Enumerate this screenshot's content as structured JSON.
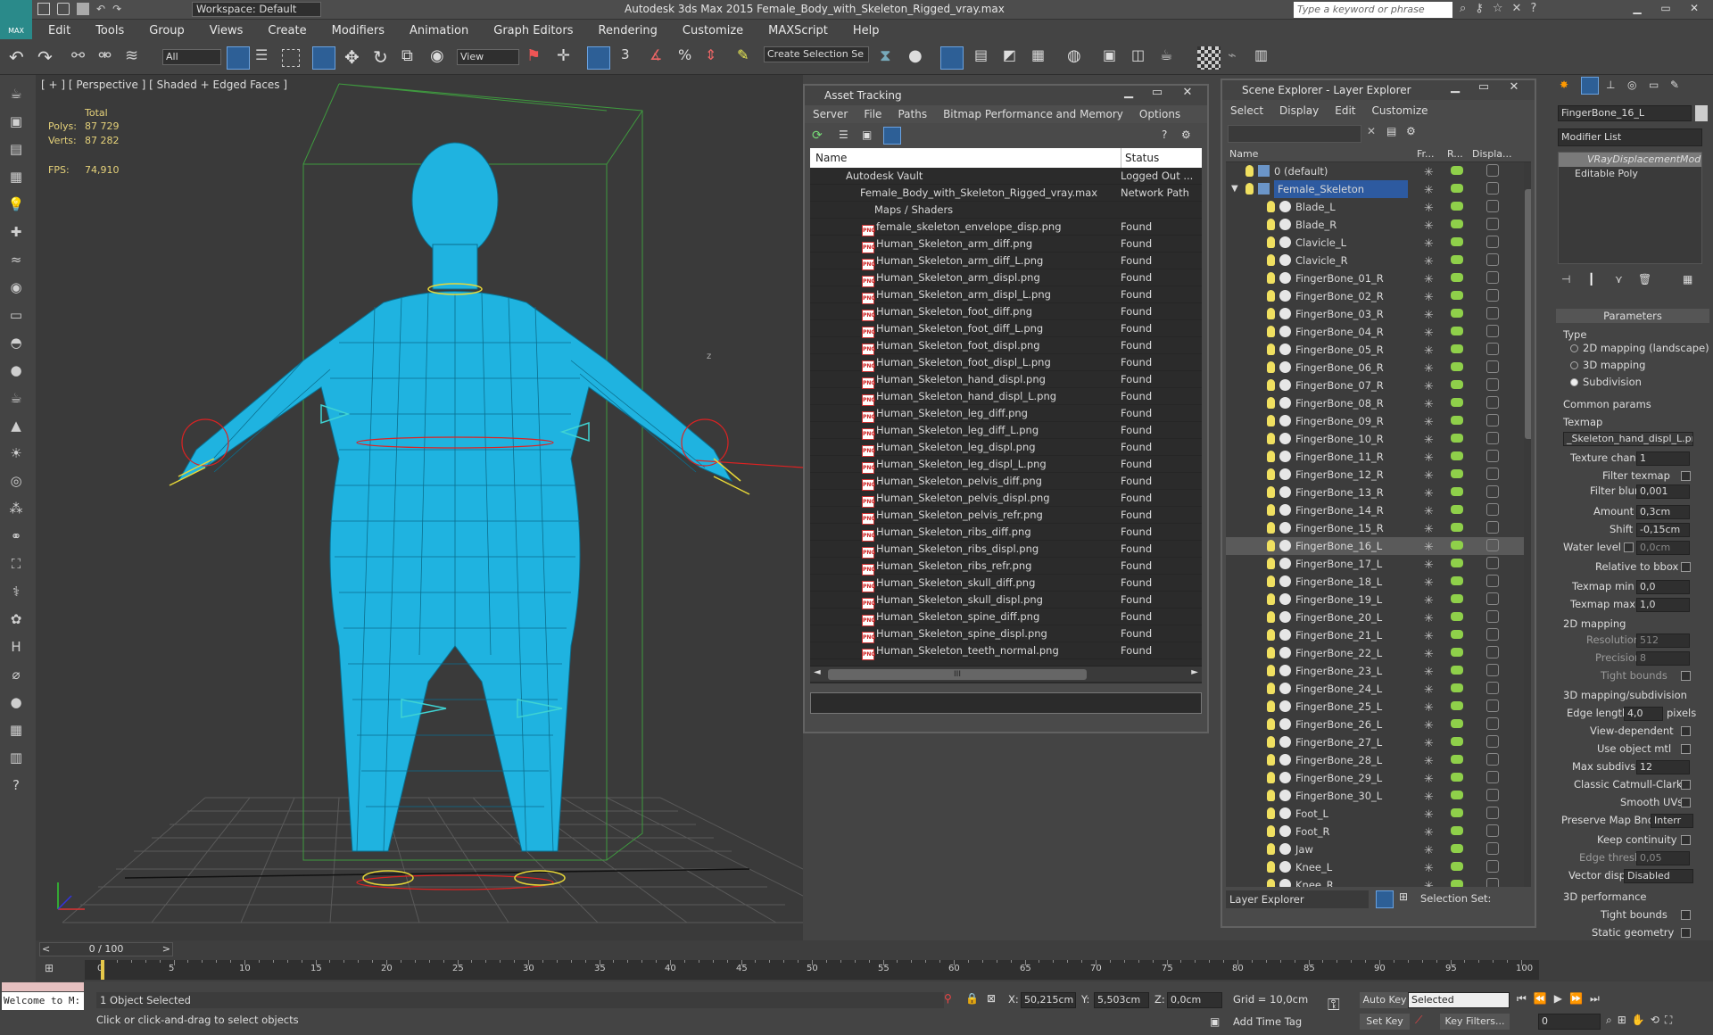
{
  "app": {
    "title": "Autodesk 3ds Max 2015    Female_Body_with_Skeleton_Rigged_vray.max",
    "workspace": "Workspace: Default",
    "search_placeholder": "Type a keyword or phrase",
    "logo": "MAX"
  },
  "menu": [
    "Edit",
    "Tools",
    "Group",
    "Views",
    "Create",
    "Modifiers",
    "Animation",
    "Graph Editors",
    "Rendering",
    "Customize",
    "MAXScript",
    "Help"
  ],
  "toolbar": {
    "filter": "All",
    "view": "View",
    "selection_set": "Create Selection Se",
    "snap3": "3",
    "angle_snap": "%"
  },
  "viewport": {
    "label": "[ + ] [ Perspective ] [ Shaded + Edged Faces ]",
    "stats_header": "Total",
    "polys_label": "Polys:",
    "polys": "87 729",
    "verts_label": "Verts:",
    "verts": "87 282",
    "fps_label": "FPS:",
    "fps": "74,910",
    "axis_z": "z"
  },
  "asset_tracking": {
    "title": "Asset Tracking",
    "menu": [
      "Server",
      "File",
      "Paths",
      "Bitmap Performance and Memory",
      "Options"
    ],
    "col_name": "Name",
    "col_status": "Status",
    "vault": {
      "name": "Autodesk Vault",
      "status": "Logged Out ..."
    },
    "file": {
      "name": "Female_Body_with_Skeleton_Rigged_vray.max",
      "status": "Network Path"
    },
    "group": "Maps / Shaders",
    "files": [
      {
        "name": "female_skeleton_envelope_disp.png",
        "status": "Found"
      },
      {
        "name": "Human_Skeleton_arm_diff.png",
        "status": "Found"
      },
      {
        "name": "Human_Skeleton_arm_diff_L.png",
        "status": "Found"
      },
      {
        "name": "Human_Skeleton_arm_displ.png",
        "status": "Found"
      },
      {
        "name": "Human_Skeleton_arm_displ_L.png",
        "status": "Found"
      },
      {
        "name": "Human_Skeleton_foot_diff.png",
        "status": "Found"
      },
      {
        "name": "Human_Skeleton_foot_diff_L.png",
        "status": "Found"
      },
      {
        "name": "Human_Skeleton_foot_displ.png",
        "status": "Found"
      },
      {
        "name": "Human_Skeleton_foot_displ_L.png",
        "status": "Found"
      },
      {
        "name": "Human_Skeleton_hand_displ.png",
        "status": "Found"
      },
      {
        "name": "Human_Skeleton_hand_displ_L.png",
        "status": "Found"
      },
      {
        "name": "Human_Skeleton_leg_diff.png",
        "status": "Found"
      },
      {
        "name": "Human_Skeleton_leg_diff_L.png",
        "status": "Found"
      },
      {
        "name": "Human_Skeleton_leg_displ.png",
        "status": "Found"
      },
      {
        "name": "Human_Skeleton_leg_displ_L.png",
        "status": "Found"
      },
      {
        "name": "Human_Skeleton_pelvis_diff.png",
        "status": "Found"
      },
      {
        "name": "Human_Skeleton_pelvis_displ.png",
        "status": "Found"
      },
      {
        "name": "Human_Skeleton_pelvis_refr.png",
        "status": "Found"
      },
      {
        "name": "Human_Skeleton_ribs_diff.png",
        "status": "Found"
      },
      {
        "name": "Human_Skeleton_ribs_displ.png",
        "status": "Found"
      },
      {
        "name": "Human_Skeleton_ribs_refr.png",
        "status": "Found"
      },
      {
        "name": "Human_Skeleton_skull_diff.png",
        "status": "Found"
      },
      {
        "name": "Human_Skeleton_skull_displ.png",
        "status": "Found"
      },
      {
        "name": "Human_Skeleton_spine_diff.png",
        "status": "Found"
      },
      {
        "name": "Human_Skeleton_spine_displ.png",
        "status": "Found"
      },
      {
        "name": "Human_Skeleton_teeth_normal.png",
        "status": "Found"
      }
    ],
    "scroll_grip": "III",
    "png_badge": "PNG"
  },
  "scene_explorer": {
    "title": "Scene Explorer - Layer Explorer",
    "menu": [
      "Select",
      "Display",
      "Edit",
      "Customize"
    ],
    "col_name": "Name",
    "col_fr": "Fr...",
    "col_r": "R...",
    "col_display": "Displa...",
    "layers": [
      {
        "name": "0 (default)",
        "level": 0
      },
      {
        "name": "Female_Skeleton",
        "level": 0,
        "selected": true
      }
    ],
    "objects": [
      "Blade_L",
      "Blade_R",
      "Clavicle_L",
      "Clavicle_R",
      "FingerBone_01_R",
      "FingerBone_02_R",
      "FingerBone_03_R",
      "FingerBone_04_R",
      "FingerBone_05_R",
      "FingerBone_06_R",
      "FingerBone_07_R",
      "FingerBone_08_R",
      "FingerBone_09_R",
      "FingerBone_10_R",
      "FingerBone_11_R",
      "FingerBone_12_R",
      "FingerBone_13_R",
      "FingerBone_14_R",
      "FingerBone_15_R",
      "FingerBone_16_L",
      "FingerBone_17_L",
      "FingerBone_18_L",
      "FingerBone_19_L",
      "FingerBone_20_L",
      "FingerBone_21_L",
      "FingerBone_22_L",
      "FingerBone_23_L",
      "FingerBone_24_L",
      "FingerBone_25_L",
      "FingerBone_26_L",
      "FingerBone_27_L",
      "FingerBone_28_L",
      "FingerBone_29_L",
      "FingerBone_30_L",
      "Foot_L",
      "Foot_R",
      "Jaw",
      "Knee_L",
      "Knee_R"
    ],
    "highlighted": "FingerBone_16_L",
    "footer_mode": "Layer Explorer",
    "footer_selset": "Selection Set:"
  },
  "command_panel": {
    "object_name": "FingerBone_16_L",
    "modifier_list": "Modifier List",
    "stack": [
      "VRayDisplacementMod",
      "Editable Poly"
    ],
    "rollout_title": "Parameters",
    "type_label": "Type",
    "type_options": [
      "2D mapping (landscape)",
      "3D mapping",
      "Subdivision"
    ],
    "common_params": "Common params",
    "texmap_label": "Texmap",
    "texmap_value": "_Skeleton_hand_displ_L.png)",
    "texture_chan_label": "Texture chan",
    "texture_chan": "1",
    "filter_texmap": "Filter texmap",
    "filter_blur_label": "Filter blur",
    "filter_blur": "0,001",
    "amount_label": "Amount",
    "amount": "0,3cm",
    "shift_label": "Shift",
    "shift": "-0,15cm",
    "water_level_label": "Water level",
    "water_level": "0,0cm",
    "relative_bbox": "Relative to bbox",
    "texmap_min_label": "Texmap min",
    "texmap_min": "0,0",
    "texmap_max_label": "Texmap max",
    "texmap_max": "1,0",
    "mapping2d": "2D mapping",
    "resolution_label": "Resolution",
    "resolution": "512",
    "precision_label": "Precision",
    "precision": "8",
    "tight_bounds": "Tight bounds",
    "mapping3d": "3D mapping/subdivision",
    "edge_length_label": "Edge length",
    "edge_length": "4,0",
    "pixels": "pixels",
    "view_dependent": "View-dependent",
    "use_object_mtl": "Use object mtl",
    "max_subdivs_label": "Max subdivs",
    "max_subdivs": "12",
    "catmull": "Classic Catmull-Clark",
    "smooth_uvs": "Smooth UVs",
    "preserve_label": "Preserve Map Bnd",
    "preserve": "Interr",
    "keep_cont": "Keep continuity",
    "edge_thresh_label": "Edge thresh",
    "edge_thresh": "0,05",
    "vector_displ_label": "Vector displ",
    "vector_displ": "Disabled",
    "perf3d": "3D performance",
    "tight_bounds2": "Tight bounds",
    "static_geom": "Static geometry"
  },
  "timeline": {
    "frame": "0 / 100",
    "ticks": [
      "0",
      "5",
      "10",
      "15",
      "20",
      "25",
      "30",
      "35",
      "40",
      "45",
      "50",
      "55",
      "60",
      "65",
      "70",
      "75",
      "80",
      "85",
      "90",
      "95",
      "100"
    ]
  },
  "status": {
    "maxscript": "Welcome to M:",
    "selected": "1 Object Selected",
    "prompt": "Click or click-and-drag to select objects",
    "x_label": "X:",
    "x": "50,215cm",
    "y_label": "Y:",
    "y": "5,503cm",
    "z_label": "Z:",
    "z": "0,0cm",
    "grid": "Grid = 10,0cm",
    "add_time_tag": "Add Time Tag",
    "auto_key": "Auto Key",
    "set_key": "Set Key",
    "selected_dd": "Selected",
    "key_filters": "Key Filters...",
    "frame_field": "0"
  }
}
